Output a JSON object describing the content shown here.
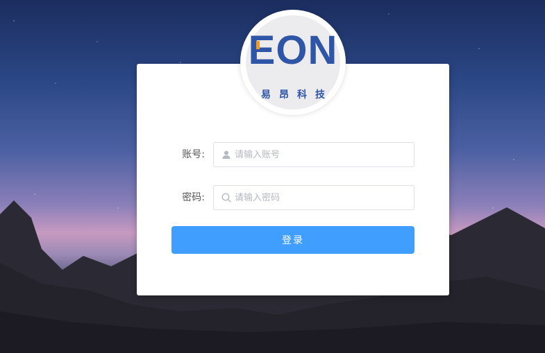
{
  "logo": {
    "text": "EON",
    "subtitle": "易昂科技"
  },
  "form": {
    "account": {
      "label": "账号:",
      "placeholder": "请输入账号",
      "icon": "user-icon"
    },
    "password": {
      "label": "密码:",
      "placeholder": "请输入密码",
      "icon": "search-icon"
    },
    "login_label": "登录"
  },
  "colors": {
    "accent": "#409eff",
    "logo_blue": "#2f56a6",
    "logo_orange": "#f39a1e"
  }
}
